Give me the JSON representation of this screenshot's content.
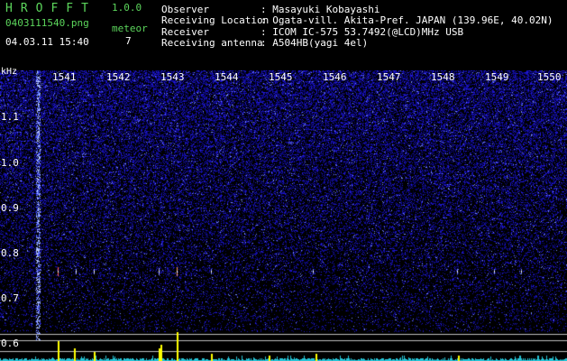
{
  "app": {
    "title": "HROFFT",
    "version": "1.0.0"
  },
  "file": {
    "name": "0403111540.png",
    "datetime": "04.03.11 15:40"
  },
  "meteor": {
    "label": "meteor",
    "count": "7"
  },
  "info": [
    {
      "key": "Observer",
      "value": ": Masayuki Kobayashi"
    },
    {
      "key": "Receiving Location",
      "value": ": Ogata-vill. Akita-Pref. JAPAN (139.96E, 40.02N)"
    },
    {
      "key": "Receiver",
      "value": ": ICOM IC-575 53.7492(@LCD)MHz USB"
    },
    {
      "key": "Receiving antenna",
      "value": ": A504HB(yagi 4el)"
    }
  ],
  "axis": {
    "unit": "kHz",
    "time_labels": [
      "1541",
      "1542",
      "1543",
      "1544",
      "1545",
      "1546",
      "1547",
      "1548",
      "1549",
      "1550"
    ],
    "freq_labels": [
      "1.1",
      "1.0",
      "0.9",
      "0.8",
      "0.7",
      "0.6"
    ]
  },
  "colors": {
    "background": "#000000",
    "noise": "#1a28c8",
    "trace": "#26c4d6",
    "peak": "#ffff00",
    "text_green": "#5cd65c"
  }
}
